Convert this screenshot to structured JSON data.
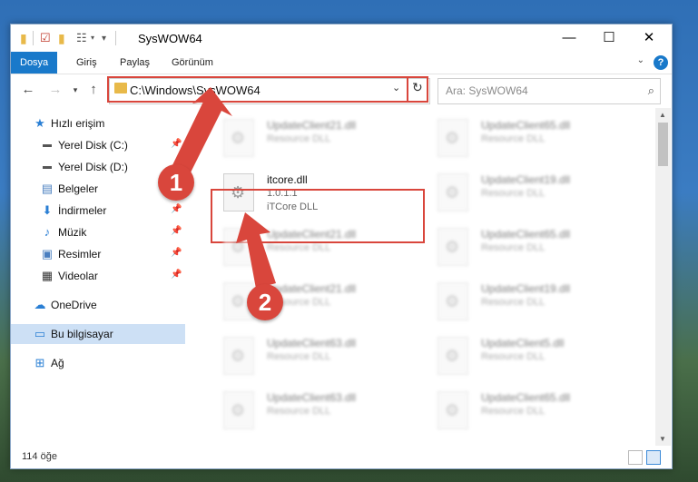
{
  "window": {
    "title": "SysWOW64",
    "controls": {
      "minimize": "—",
      "maximize": "☐",
      "close": "✕"
    }
  },
  "ribbon": {
    "tabs": [
      "Dosya",
      "Giriş",
      "Paylaş",
      "Görünüm"
    ],
    "active_tab": "Dosya",
    "help": "?"
  },
  "navigation": {
    "address_path": "C:\\Windows\\SysWOW64",
    "search_placeholder": "Ara: SysWOW64"
  },
  "sidebar": {
    "items": [
      {
        "label": "Hızlı erişim",
        "icon": "star-icon",
        "pinned": false
      },
      {
        "label": "Yerel Disk (C:)",
        "icon": "drive-icon",
        "pinned": true
      },
      {
        "label": "Yerel Disk (D:)",
        "icon": "drive-icon",
        "pinned": false
      },
      {
        "label": "Belgeler",
        "icon": "document-icon",
        "pinned": true
      },
      {
        "label": "İndirmeler",
        "icon": "download-icon",
        "pinned": true
      },
      {
        "label": "Müzik",
        "icon": "music-icon",
        "pinned": true
      },
      {
        "label": "Resimler",
        "icon": "pictures-icon",
        "pinned": true
      },
      {
        "label": "Videolar",
        "icon": "video-icon",
        "pinned": true
      },
      {
        "label": "OneDrive",
        "icon": "cloud-icon",
        "pinned": false
      },
      {
        "label": "Bu bilgisayar",
        "icon": "computer-icon",
        "pinned": false,
        "selected": true
      },
      {
        "label": "Ağ",
        "icon": "network-icon",
        "pinned": false
      }
    ]
  },
  "files": {
    "highlighted": {
      "name": "itcore.dll",
      "version": "1.0.1.1",
      "type": "iTCore DLL"
    },
    "background": [
      {
        "name": "UpdateClient21.dll",
        "type": "Resource DLL"
      },
      {
        "name": "UpdateClient65.dll",
        "type": "Resource DLL"
      },
      {
        "name": "UpdateClient19.dll",
        "type": "Resource DLL"
      },
      {
        "name": "UpdateClient21.dll",
        "type": "Resource DLL"
      },
      {
        "name": "UpdateClient65.dll",
        "type": "Resource DLL"
      },
      {
        "name": "UpdateClient21.dll",
        "type": "Resource DLL"
      },
      {
        "name": "UpdateClient19.dll",
        "type": "Resource DLL"
      },
      {
        "name": "UpdateClient63.dll",
        "type": "Resource DLL"
      },
      {
        "name": "UpdateClient5.dll",
        "type": "Resource DLL"
      },
      {
        "name": "UpdateClient63.dll",
        "type": "Resource DLL"
      },
      {
        "name": "UpdateClient65.dll",
        "type": "Resource DLL"
      }
    ]
  },
  "status": {
    "item_count": "114 öğe"
  },
  "callouts": {
    "step1": "1",
    "step2": "2"
  },
  "colors": {
    "accent": "#1979ca",
    "highlight": "#d9463c",
    "selected": "#cde0f5"
  }
}
